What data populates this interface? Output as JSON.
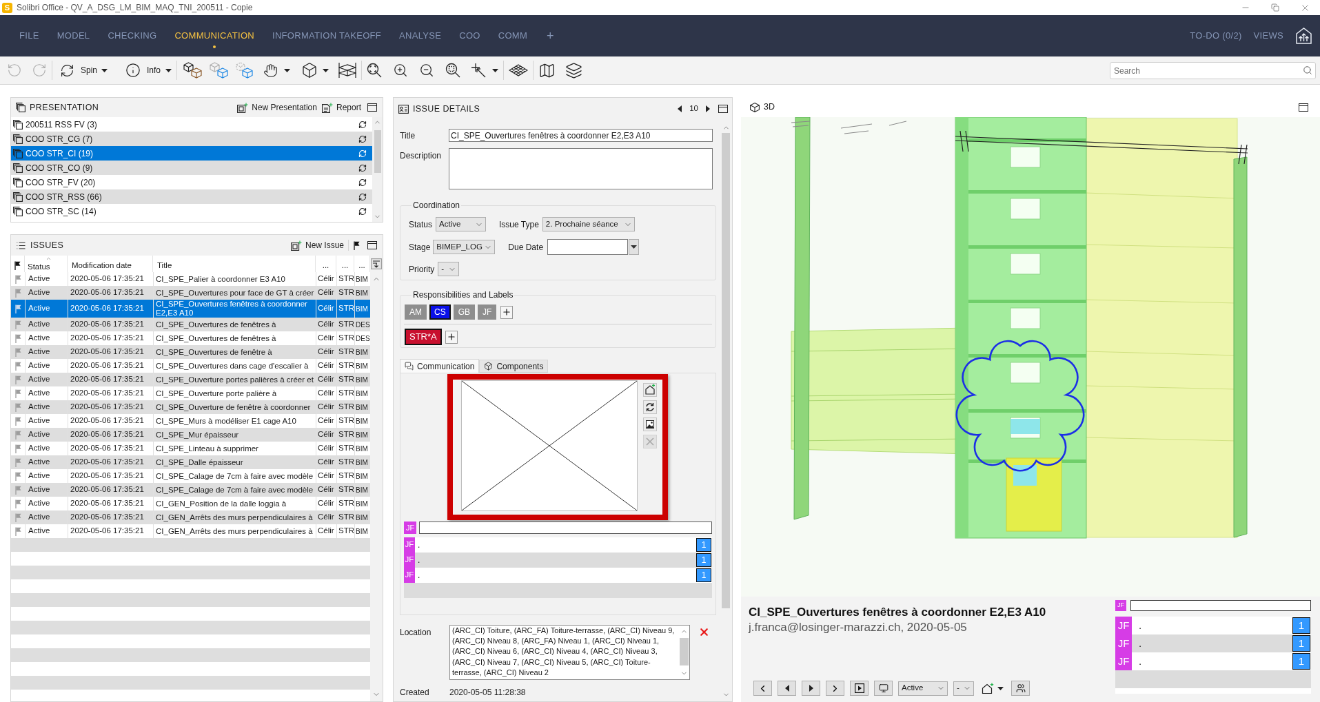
{
  "window": {
    "logo": "S",
    "title": "Solibri Office - QV_A_DSG_LM_BIM_MAQ_TNI_200511 - Copie"
  },
  "menu": {
    "tabs": [
      {
        "label": "FILE",
        "selected": false
      },
      {
        "label": "MODEL",
        "selected": false
      },
      {
        "label": "CHECKING",
        "selected": false
      },
      {
        "label": "COMMUNICATION",
        "selected": true
      },
      {
        "label": "INFORMATION TAKEOFF",
        "selected": false
      },
      {
        "label": "ANALYSE",
        "selected": false
      },
      {
        "label": "COO",
        "selected": false
      },
      {
        "label": "COMM",
        "selected": false
      }
    ],
    "add": "+",
    "todo": "TO-DO (0/2)",
    "views": "VIEWS"
  },
  "toolbar": {
    "undo": {
      "disabled": true
    },
    "redo": {
      "disabled": true
    },
    "spin": "Spin",
    "info": "Info",
    "search": {
      "placeholder": "Search"
    }
  },
  "presentation": {
    "title": "PRESENTATION",
    "new_presentation": "New Presentation",
    "report": "Report",
    "items": [
      {
        "label": "200511 RSS FV (3)",
        "selected": false
      },
      {
        "label": "COO STR_CG (7)",
        "selected": false
      },
      {
        "label": "COO STR_CI (19)",
        "selected": true
      },
      {
        "label": "COO STR_CO (9)",
        "selected": false
      },
      {
        "label": "COO STR_FV (20)",
        "selected": false
      },
      {
        "label": "COO STR_RSS (66)",
        "selected": false
      },
      {
        "label": "COO STR_SC (14)",
        "selected": false
      }
    ]
  },
  "issues": {
    "title": "ISSUES",
    "new_issue": "New Issue",
    "columns": [
      "Status",
      "Modification date",
      "Title",
      "...",
      "...",
      "..."
    ],
    "rows": [
      {
        "status": "Active",
        "modified": "2020-05-06 17:35:21",
        "title": "CI_SPE_Palier à coordonner E3 A10",
        "column_4": "Célir",
        "column_5": "STR",
        "column_6": "BIM",
        "selected": false
      },
      {
        "status": "Active",
        "modified": "2020-05-06 17:35:21",
        "title": "CI_SPE_Ouvertures pour face de GT à créer",
        "column_4": "Célir",
        "column_5": "STR",
        "column_6": "BIM",
        "selected": false
      },
      {
        "status": "Active",
        "modified": "2020-05-06 17:35:21",
        "title": "CI_SPE_Ouvertures fenêtres à coordonner E2,E3 A10",
        "column_4": "Célir",
        "column_5": "STR",
        "column_6": "BIM",
        "selected": true
      },
      {
        "status": "Active",
        "modified": "2020-05-06 17:35:21",
        "title": "CI_SPE_Ouvertures de fenêtres à",
        "column_4": "Célir",
        "column_5": "STR",
        "column_6": "DES",
        "selected": false
      },
      {
        "status": "Active",
        "modified": "2020-05-06 17:35:21",
        "title": "CI_SPE_Ouvertures de fenêtres à",
        "column_4": "Célir",
        "column_5": "STR",
        "column_6": "DES",
        "selected": false
      },
      {
        "status": "Active",
        "modified": "2020-05-06 17:35:21",
        "title": "CI_SPE_Ouvertures de fenêtre à",
        "column_4": "Célir",
        "column_5": "STR",
        "column_6": "BIM",
        "selected": false
      },
      {
        "status": "Active",
        "modified": "2020-05-06 17:35:21",
        "title": "CI_SPE_Ouvertures dans cage d'escalier à",
        "column_4": "Célir",
        "column_5": "STR",
        "column_6": "BIM",
        "selected": false
      },
      {
        "status": "Active",
        "modified": "2020-05-06 17:35:21",
        "title": "CI_SPE_Ouverture portes palières à créer et",
        "column_4": "Célir",
        "column_5": "STR",
        "column_6": "BIM",
        "selected": false
      },
      {
        "status": "Active",
        "modified": "2020-05-06 17:35:21",
        "title": "CI_SPE_Ouverture porte palière à",
        "column_4": "Célir",
        "column_5": "STR",
        "column_6": "BIM",
        "selected": false
      },
      {
        "status": "Active",
        "modified": "2020-05-06 17:35:21",
        "title": "CI_SPE_Ouverture de fenêtre à coordonner",
        "column_4": "Célir",
        "column_5": "STR",
        "column_6": "BIM",
        "selected": false
      },
      {
        "status": "Active",
        "modified": "2020-05-06 17:35:21",
        "title": "CI_SPE_Murs à modéliser E1 cage A10",
        "column_4": "Célir",
        "column_5": "STR",
        "column_6": "BIM",
        "selected": false
      },
      {
        "status": "Active",
        "modified": "2020-05-06 17:35:21",
        "title": "CI_SPE_Mur épaisseur",
        "column_4": "Célir",
        "column_5": "STR",
        "column_6": "BIM",
        "selected": false
      },
      {
        "status": "Active",
        "modified": "2020-05-06 17:35:21",
        "title": "CI_SPE_Linteau à supprimer",
        "column_4": "Célir",
        "column_5": "STR",
        "column_6": "BIM",
        "selected": false
      },
      {
        "status": "Active",
        "modified": "2020-05-06 17:35:21",
        "title": "CI_SPE_Dalle épaisseur",
        "column_4": "Célir",
        "column_5": "STR",
        "column_6": "BIM",
        "selected": false
      },
      {
        "status": "Active",
        "modified": "2020-05-06 17:35:21",
        "title": "CI_SPE_Calage de 7cm à faire avec modèle",
        "column_4": "Célir",
        "column_5": "STR",
        "column_6": "BIM",
        "selected": false
      },
      {
        "status": "Active",
        "modified": "2020-05-06 17:35:21",
        "title": "CI_SPE_Calage de 7cm à faire avec modèle",
        "column_4": "Célir",
        "column_5": "STR",
        "column_6": "BIM",
        "selected": false
      },
      {
        "status": "Active",
        "modified": "2020-05-06 17:35:21",
        "title": "CI_GEN_Position de la dalle loggia à",
        "column_4": "Célir",
        "column_5": "STR",
        "column_6": "BIM",
        "selected": false
      },
      {
        "status": "Active",
        "modified": "2020-05-06 17:35:21",
        "title": "CI_GEN_Arrêts des murs perpendiculaires à",
        "column_4": "Célir",
        "column_5": "STR",
        "column_6": "BIM",
        "selected": false
      },
      {
        "status": "Active",
        "modified": "2020-05-06 17:35:21",
        "title": "CI_GEN_Arrêts des murs perpendiculaires à",
        "column_4": "Célir",
        "column_5": "STR",
        "column_6": "BIM",
        "selected": false
      }
    ]
  },
  "details": {
    "title": "ISSUE DETAILS",
    "index": "10",
    "title_field": {
      "label": "Title",
      "value": "CI_SPE_Ouvertures fenêtres à coordonner E2,E3 A10"
    },
    "description_field": {
      "label": "Description"
    },
    "coordination": {
      "title": "Coordination",
      "status": {
        "label": "Status",
        "value": "Active"
      },
      "issue_type": {
        "label": "Issue Type",
        "value": "2. Prochaine séance"
      },
      "stage": {
        "label": "Stage",
        "value": "BIMEP_LOG"
      },
      "due_date": {
        "label": "Due Date"
      },
      "priority": {
        "label": "Priority",
        "value": "-"
      }
    },
    "responsibilities": {
      "title": "Responsibilities and Labels",
      "people": [
        {
          "initials": "AM",
          "selected": false
        },
        {
          "initials": "CS",
          "selected": true
        },
        {
          "initials": "GB",
          "selected": false
        },
        {
          "initials": "JF",
          "selected": false
        }
      ],
      "labels": [
        {
          "label": "STR*A",
          "color": "#c8102e"
        }
      ]
    },
    "tabs": [
      {
        "label": "Communication",
        "selected": true
      },
      {
        "label": "Components",
        "selected": false
      }
    ],
    "snapshot": {
      "delete": {
        "disabled": true
      }
    },
    "comment_input": {
      "author": "JF"
    },
    "comments": [
      {
        "author": "JF",
        "text": ".",
        "count": "1"
      },
      {
        "author": "JF",
        "text": ".",
        "count": "1"
      },
      {
        "author": "JF",
        "text": ".",
        "count": "1"
      }
    ],
    "location": {
      "label": "Location",
      "value": "(ARC_CI) Toiture, (ARC_FA) Toiture-terrasse, (ARC_CI) Niveau 9, (ARC_CI) Niveau 8, (ARC_FA) Niveau 1, (ARC_CI) Niveau 1, (ARC_CI) Niveau 6, (ARC_CI) Niveau 4, (ARC_CI) Niveau 3, (ARC_CI) Niveau 7, (ARC_CI) Niveau 5, (ARC_CI) Toiture-terrasse, (ARC_CI) Niveau 2"
    },
    "created": {
      "label": "Created",
      "value": "2020-05-05 11:28:38"
    }
  },
  "viewer": {
    "title": "3D",
    "issue_title": "CI_SPE_Ouvertures fenêtres à coordonner E2,E3 A10",
    "meta": "j.franca@losinger-marazzi.ch, 2020-05-05",
    "status": "Active",
    "priority": "-",
    "comment_input": {
      "author": "JF"
    },
    "comments": [
      {
        "author": "JF",
        "text": ".",
        "count": "1"
      },
      {
        "author": "JF",
        "text": ".",
        "count": "1"
      },
      {
        "author": "JF",
        "text": ".",
        "count": "1"
      }
    ]
  }
}
